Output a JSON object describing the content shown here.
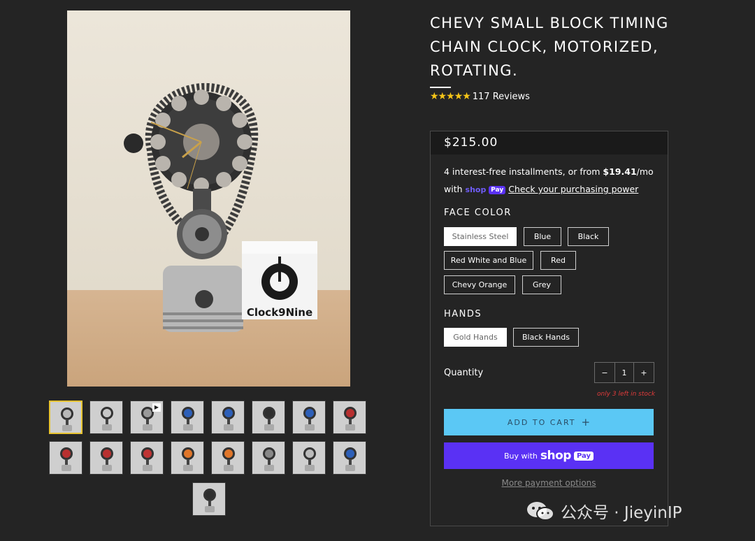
{
  "product": {
    "title": "CHEVY SMALL BLOCK TIMING CHAIN CLOCK, MOTORIZED, ROTATING.",
    "stars": "★★★★★",
    "reviews": "117 Reviews",
    "price": "$215.00",
    "image_box_label": "Clock9Nine"
  },
  "installments": {
    "text_before": "4 interest-free installments, or from ",
    "amount": "$19.41",
    "text_after": "/mo",
    "with": "with",
    "shop_word": "shop",
    "pay_word": "Pay",
    "link": "Check your purchasing power"
  },
  "face_color": {
    "label": "FACE COLOR",
    "options": [
      "Stainless Steel",
      "Blue",
      "Black",
      "Red White and Blue",
      "Red",
      "Chevy Orange",
      "Grey"
    ],
    "selected": "Stainless Steel"
  },
  "hands": {
    "label": "HANDS",
    "options": [
      "Gold Hands",
      "Black Hands"
    ],
    "selected": "Gold Hands"
  },
  "quantity": {
    "label": "Quantity",
    "minus": "−",
    "value": "1",
    "plus": "+",
    "stock_note": "only 3 left in stock"
  },
  "buttons": {
    "add_to_cart": "ADD TO CART",
    "add_icon": "+",
    "buy_with": "Buy with",
    "buy_shop": "shop",
    "buy_pay": "Pay",
    "more_options": "More payment options"
  },
  "thumbnails": {
    "count": 17,
    "play_icon": "▶",
    "accent_colors": [
      "#b8b8b8",
      "#c8c8c8",
      "#9a9a9a",
      "#2d5fb8",
      "#2d5fb8",
      "#2e2e2e",
      "#2d5fb8",
      "#b83030",
      "#b83030",
      "#b83030",
      "#c03434",
      "#e0762a",
      "#e0762a",
      "#888888",
      "#bbbbbb",
      "#2d5fb8",
      "#2e2e2e"
    ]
  },
  "watermark": {
    "text": "公众号 · JieyinIP"
  },
  "colors": {
    "background": "#242424",
    "add_to_cart_bg": "#5bc8f5",
    "shop_pay_purple": "#5a31f4",
    "star_yellow": "#f5c518",
    "stock_red": "#e23b3b"
  }
}
